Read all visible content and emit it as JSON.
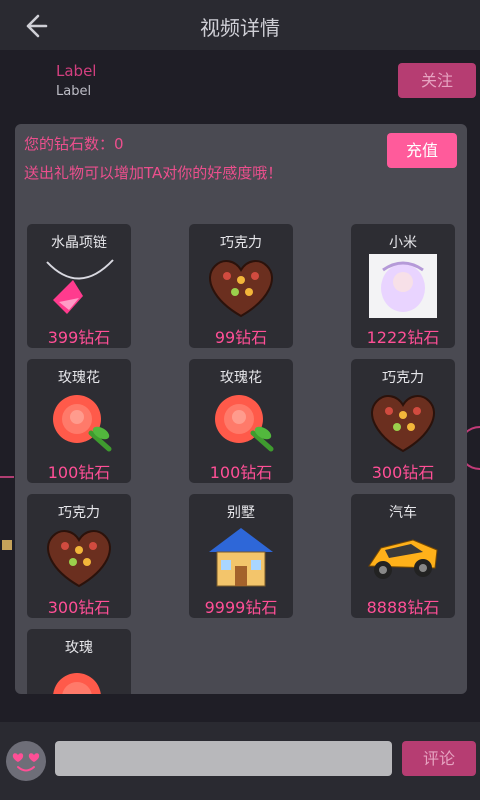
{
  "header": {
    "title": "视频详情",
    "back_icon": "back-arrow-icon"
  },
  "user": {
    "name": "Label",
    "subtitle": "Label",
    "follow_label": "关注"
  },
  "dialog": {
    "balance": "您的钻石数：0",
    "hint": "送出礼物可以增加TA对你的好感度哦！",
    "recharge_label": "充值",
    "gifts": [
      {
        "name": "水晶项链",
        "price": "399钻石",
        "icon": "necklace-icon"
      },
      {
        "name": "巧克力",
        "price": "99钻石",
        "icon": "chocolate-icon"
      },
      {
        "name": "小米",
        "price": "1222钻石",
        "icon": "anime-girl-icon"
      },
      {
        "name": "玫瑰花",
        "price": "100钻石",
        "icon": "rose-icon"
      },
      {
        "name": "玫瑰花",
        "price": "100钻石",
        "icon": "rose-icon"
      },
      {
        "name": "巧克力",
        "price": "300钻石",
        "icon": "chocolate-icon"
      },
      {
        "name": "巧克力",
        "price": "300钻石",
        "icon": "chocolate-icon"
      },
      {
        "name": "别墅",
        "price": "9999钻石",
        "icon": "house-icon"
      },
      {
        "name": "汽车",
        "price": "8888钻石",
        "icon": "car-icon"
      },
      {
        "name": "玫瑰",
        "price": "",
        "icon": "rose-icon"
      }
    ]
  },
  "footer": {
    "comment_placeholder": "",
    "comment_label": "评论"
  },
  "colors": {
    "accent": "#ff5b9b",
    "price": "#ff4f96",
    "dialog_bg": "#4a4a52",
    "card_bg": "#2d2d33"
  }
}
